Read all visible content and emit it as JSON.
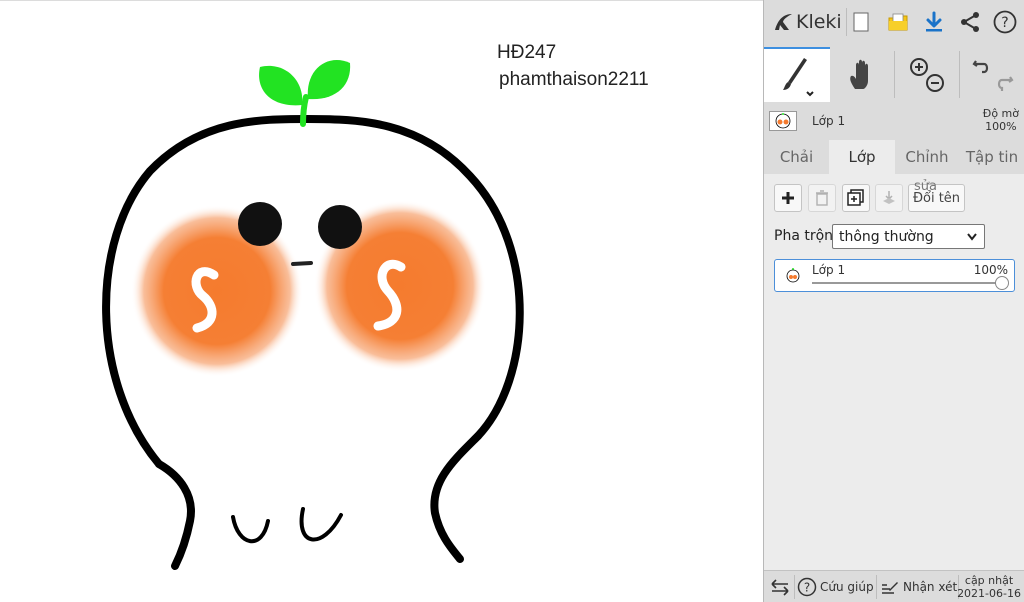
{
  "canvas": {
    "texts": [
      "HĐ247",
      "phamthaison2211"
    ]
  },
  "app": {
    "name": "Kleki"
  },
  "topbar_icons": [
    "new-image-icon",
    "open-image-icon",
    "download-icon",
    "share-icon",
    "help-icon"
  ],
  "tools": [
    "brush-tool",
    "hand-tool",
    "zoom-tool",
    "undo-redo-tool"
  ],
  "layer_info": {
    "name": "Lớp 1",
    "opacity_label": "Độ mờ",
    "opacity_value": "100%"
  },
  "tabs": [
    "Chải",
    "Lớp",
    "Chỉnh",
    "Tập tin"
  ],
  "active_tab": "Lớp",
  "layer_panel": {
    "rename_ghost": "sửa",
    "rename_label": "Đổi tên",
    "blend_label": "Pha trộn",
    "blend_value": "thông thường",
    "layers": [
      {
        "name": "Lớp 1",
        "opacity": "100%"
      }
    ]
  },
  "bottom": {
    "help": "Cứu giúp",
    "feedback": "Nhận xét",
    "updated_label": "cập nhật",
    "updated_date": "2021-06-16"
  },
  "colors": {
    "accent": "#3d8fe0",
    "sprout": "#22e322",
    "blush": "#f57b2e",
    "download": "#1a73c9",
    "folder": "#f5c518"
  }
}
